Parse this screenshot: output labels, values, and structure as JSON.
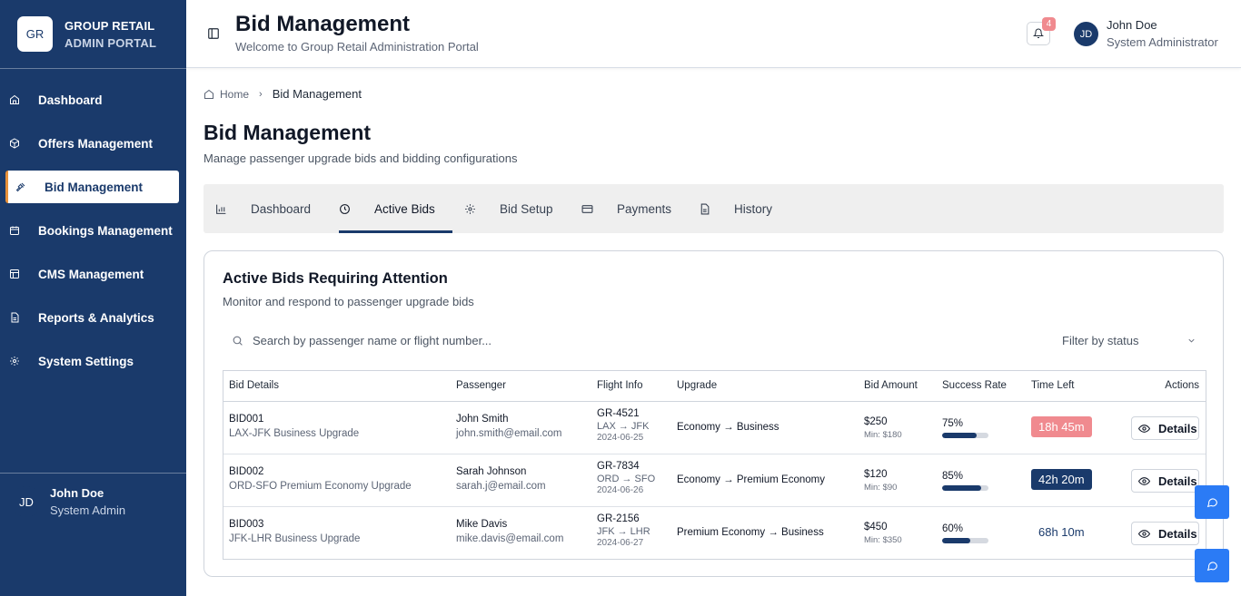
{
  "brand": {
    "logo_text": "GR",
    "line1": "GROUP RETAIL",
    "line2": "ADMIN PORTAL"
  },
  "sidebar": {
    "items": [
      {
        "label": "Dashboard",
        "icon": "home-icon"
      },
      {
        "label": "Offers Management",
        "icon": "package-icon"
      },
      {
        "label": "Bid Management",
        "icon": "gavel-icon",
        "active": true
      },
      {
        "label": "Bookings Management",
        "icon": "calendar-icon"
      },
      {
        "label": "CMS Management",
        "icon": "layout-icon"
      },
      {
        "label": "Reports & Analytics",
        "icon": "file-icon"
      },
      {
        "label": "System Settings",
        "icon": "gear-icon"
      }
    ],
    "user": {
      "initials": "JD",
      "name": "John Doe",
      "role": "System Admin"
    }
  },
  "header": {
    "title": "Bid Management",
    "subtitle": "Welcome to Group Retail Administration Portal",
    "notification_count": "4",
    "user": {
      "initials": "JD",
      "name": "John Doe",
      "role": "System Administrator"
    }
  },
  "breadcrumb": {
    "home": "Home",
    "current": "Bid Management"
  },
  "page": {
    "title": "Bid Management",
    "description": "Manage passenger upgrade bids and bidding configurations"
  },
  "tabs": [
    {
      "label": "Dashboard",
      "icon": "bar-chart-icon"
    },
    {
      "label": "Active Bids",
      "icon": "clock-icon",
      "active": true
    },
    {
      "label": "Bid Setup",
      "icon": "gear-icon"
    },
    {
      "label": "Payments",
      "icon": "credit-card-icon"
    },
    {
      "label": "History",
      "icon": "file-text-icon"
    }
  ],
  "card": {
    "title": "Active Bids Requiring Attention",
    "description": "Monitor and respond to passenger upgrade bids",
    "search_placeholder": "Search by passenger name or flight number...",
    "filter_label": "Filter by status"
  },
  "table": {
    "headers": {
      "bid_details": "Bid Details",
      "passenger": "Passenger",
      "flight_info": "Flight Info",
      "upgrade": "Upgrade",
      "bid_amount": "Bid Amount",
      "success_rate": "Success Rate",
      "time_left": "Time Left",
      "actions": "Actions"
    },
    "details_label": "Details",
    "rows": [
      {
        "id": "BID001",
        "desc": "LAX-JFK Business Upgrade",
        "name": "John Smith",
        "email": "john.smith@email.com",
        "flight": "GR-4521",
        "route": "LAX → JFK",
        "date": "2024-06-25",
        "upgrade": "Economy → Business",
        "amount": "$250",
        "min": "Min: $180",
        "rate": "75%",
        "rate_value": 0.75,
        "time": "18h 45m",
        "time_bg": "#f08a8f",
        "time_fg": "#ffffff"
      },
      {
        "id": "BID002",
        "desc": "ORD-SFO Premium Economy Upgrade",
        "name": "Sarah Johnson",
        "email": "sarah.j@email.com",
        "flight": "GR-7834",
        "route": "ORD → SFO",
        "date": "2024-06-26",
        "upgrade": "Economy → Premium Economy",
        "amount": "$120",
        "min": "Min: $90",
        "rate": "85%",
        "rate_value": 0.85,
        "time": "42h 20m",
        "time_bg": "#1a3a6b",
        "time_fg": "#ffffff"
      },
      {
        "id": "BID003",
        "desc": "JFK-LHR Business Upgrade",
        "name": "Mike Davis",
        "email": "mike.davis@email.com",
        "flight": "GR-2156",
        "route": "JFK → LHR",
        "date": "2024-06-27",
        "upgrade": "Premium Economy → Business",
        "amount": "$450",
        "min": "Min: $350",
        "rate": "60%",
        "rate_value": 0.6,
        "time": "68h 10m",
        "time_bg": "transparent",
        "time_fg": "#1a3a6b"
      }
    ]
  },
  "colors": {
    "sidebar_bg": "#1a3a6b",
    "accent": "#e8913a",
    "chat_button": "#2b7bf5",
    "badge": "#f08a8f"
  }
}
